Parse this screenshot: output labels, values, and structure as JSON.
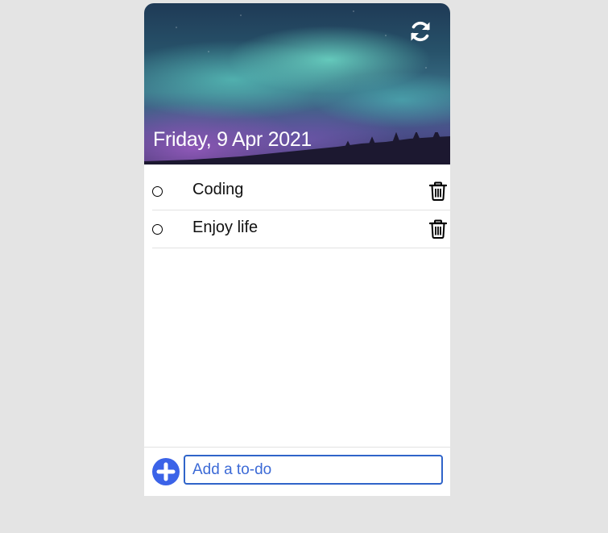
{
  "header": {
    "date": "Friday, 9 Apr 2021",
    "refresh_icon": "refresh-icon"
  },
  "todos": [
    {
      "label": "Coding",
      "completed": false,
      "check_icon": "circle-outline-icon",
      "delete_icon": "trash-icon"
    },
    {
      "label": "Enjoy life",
      "completed": false,
      "check_icon": "circle-outline-icon",
      "delete_icon": "trash-icon"
    }
  ],
  "footer": {
    "add_icon": "plus-circle-icon",
    "input_placeholder": "Add a to-do",
    "input_value": ""
  },
  "colors": {
    "accent": "#3b63e8",
    "input_border": "#2f64c9",
    "page_background": "#e4e4e4"
  }
}
